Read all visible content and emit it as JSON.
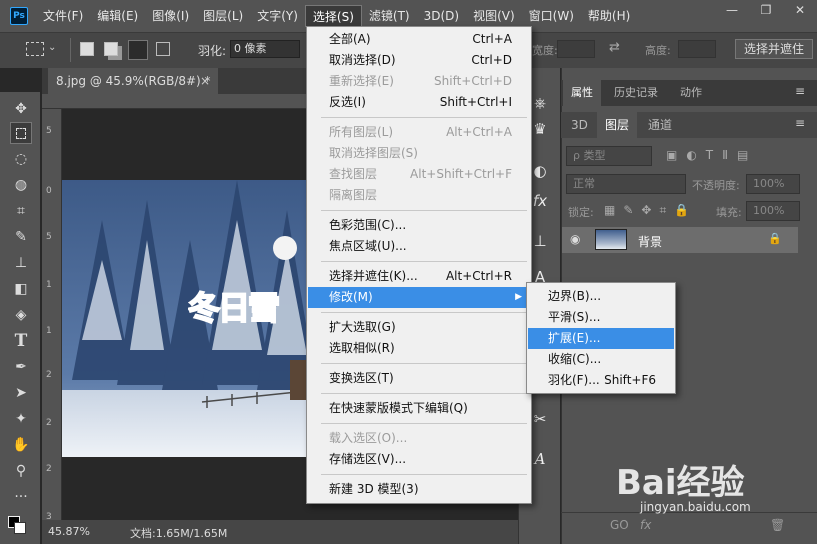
{
  "menubar": {
    "logo": "Ps",
    "items": [
      "文件(F)",
      "编辑(E)",
      "图像(I)",
      "图层(L)",
      "文字(Y)",
      "选择(S)",
      "滤镜(T)",
      "3D(D)",
      "视图(V)",
      "窗口(W)",
      "帮助(H)"
    ],
    "active_index": 5,
    "window_controls": [
      "—",
      "❐",
      "✕"
    ]
  },
  "options_bar": {
    "feather_label": "羽化:",
    "feather_value": "0 像素",
    "width_label": "宽度:",
    "height_label": "高度:",
    "select_mask_button": "选择并遮住"
  },
  "document": {
    "tab_title": "8.jpg @ 45.9%(RGB/8#) *",
    "tab_close": "×",
    "zoom": "45.87%",
    "doc_info": "文档:1.65M/1.65M",
    "ruler_marks": [
      "5",
      "0",
      "5",
      "1",
      "1",
      "2",
      "2",
      "2",
      "3",
      "3",
      "4"
    ],
    "image_text": "冬日雪"
  },
  "select_menu": {
    "items": [
      {
        "label": "全部(A)",
        "shortcut": "Ctrl+A",
        "disabled": false
      },
      {
        "label": "取消选择(D)",
        "shortcut": "Ctrl+D",
        "disabled": false
      },
      {
        "label": "重新选择(E)",
        "shortcut": "Shift+Ctrl+D",
        "disabled": true
      },
      {
        "label": "反选(I)",
        "shortcut": "Shift+Ctrl+I",
        "disabled": false
      },
      {
        "label": "所有图层(L)",
        "shortcut": "Alt+Ctrl+A",
        "disabled": true
      },
      {
        "label": "取消选择图层(S)",
        "shortcut": "",
        "disabled": true
      },
      {
        "label": "查找图层",
        "shortcut": "Alt+Shift+Ctrl+F",
        "disabled": true
      },
      {
        "label": "隔离图层",
        "shortcut": "",
        "disabled": true
      },
      {
        "label": "色彩范围(C)...",
        "shortcut": "",
        "disabled": false
      },
      {
        "label": "焦点区域(U)...",
        "shortcut": "",
        "disabled": false
      },
      {
        "label": "选择并遮住(K)...",
        "shortcut": "Alt+Ctrl+R",
        "disabled": false
      },
      {
        "label": "修改(M)",
        "shortcut": "",
        "disabled": false,
        "highlighted": true,
        "submenu": true
      },
      {
        "label": "扩大选取(G)",
        "shortcut": "",
        "disabled": false
      },
      {
        "label": "选取相似(R)",
        "shortcut": "",
        "disabled": false
      },
      {
        "label": "变换选区(T)",
        "shortcut": "",
        "disabled": false
      },
      {
        "label": "在快速蒙版模式下编辑(Q)",
        "shortcut": "",
        "disabled": false
      },
      {
        "label": "载入选区(O)...",
        "shortcut": "",
        "disabled": true
      },
      {
        "label": "存储选区(V)...",
        "shortcut": "",
        "disabled": false
      },
      {
        "label": "新建 3D 模型(3)",
        "shortcut": "",
        "disabled": false
      }
    ],
    "submenu_arrow": "▶"
  },
  "modify_submenu": {
    "items": [
      {
        "label": "边界(B)...",
        "shortcut": ""
      },
      {
        "label": "平滑(S)...",
        "shortcut": ""
      },
      {
        "label": "扩展(E)...",
        "shortcut": "",
        "highlighted": true
      },
      {
        "label": "收缩(C)...",
        "shortcut": ""
      },
      {
        "label": "羽化(F)...",
        "shortcut": "Shift+F6"
      }
    ]
  },
  "right_panel": {
    "top_tabs": [
      "属性",
      "历史记录",
      "动作"
    ],
    "layer_tabs": [
      "3D",
      "图层",
      "通道"
    ],
    "kind_filter": "ρ 类型",
    "blend_mode": "正常",
    "opacity_label": "不透明度:",
    "opacity_value": "100%",
    "lock_label": "锁定:",
    "fill_label": "填充:",
    "fill_value": "100%",
    "layer_name": "背景",
    "footer_icons": [
      "GO",
      "fx"
    ]
  },
  "watermark": {
    "text": "Bai经验",
    "url": "jingyan.baidu.com"
  },
  "colors": {
    "highlight": "#3a8ee6",
    "ui_dark": "#535353",
    "menu_bg": "#f0f0f0"
  }
}
